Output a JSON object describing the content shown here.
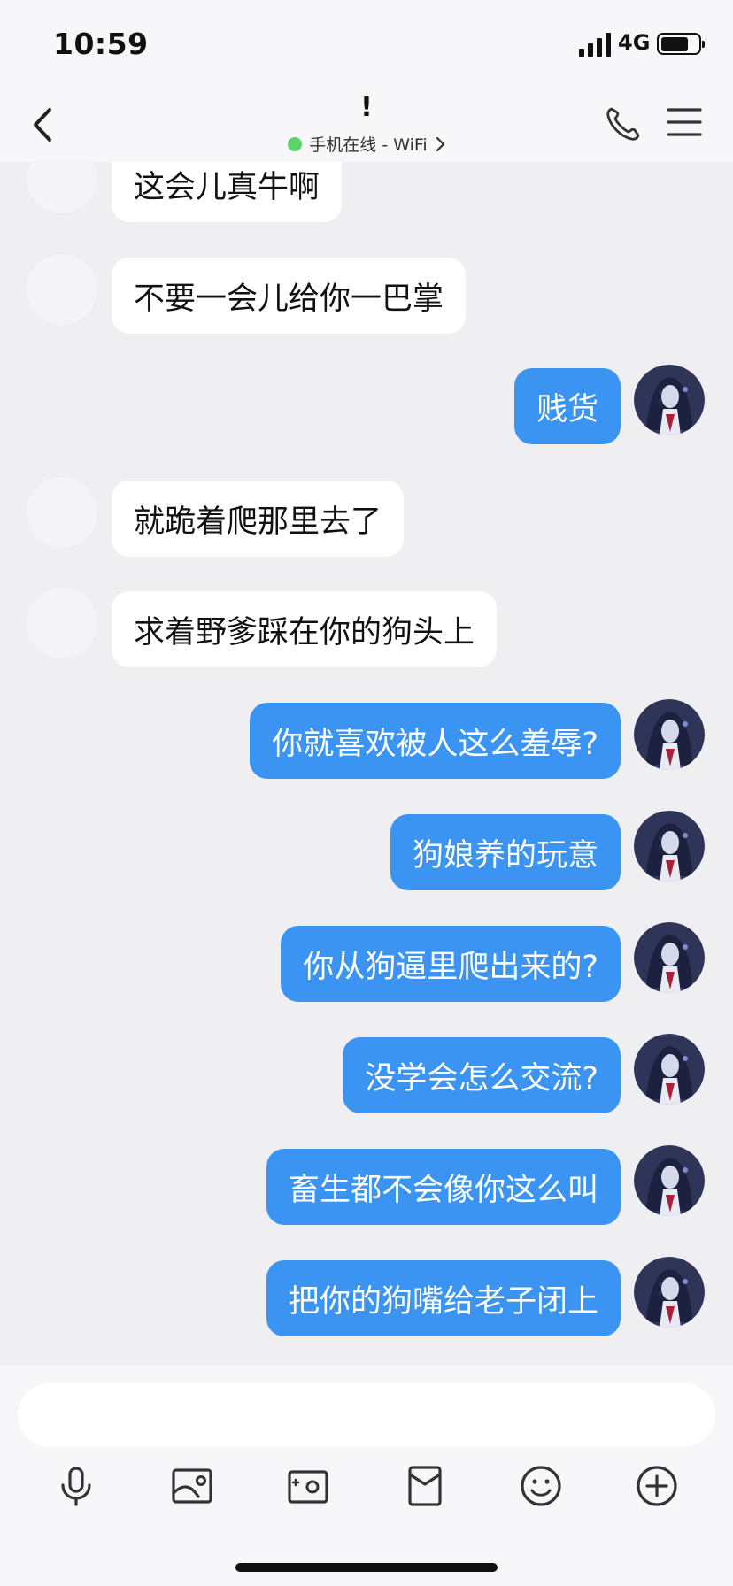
{
  "status_bar": {
    "time": "10:59",
    "network": "4G"
  },
  "header": {
    "title": "!",
    "presence_text": "手机在线 - WiFi"
  },
  "messages": [
    {
      "side": "in",
      "text": "这会儿真牛啊"
    },
    {
      "side": "in",
      "text": "不要一会儿给你一巴掌"
    },
    {
      "side": "out",
      "text": "贱货"
    },
    {
      "side": "in",
      "text": "就跪着爬那里去了"
    },
    {
      "side": "in",
      "text": "求着野爹踩在你的狗头上"
    },
    {
      "side": "out",
      "text": "你就喜欢被人这么羞辱?"
    },
    {
      "side": "out",
      "text": "狗娘养的玩意"
    },
    {
      "side": "out",
      "text": "你从狗逼里爬出来的?"
    },
    {
      "side": "out",
      "text": "没学会怎么交流?"
    },
    {
      "side": "out",
      "text": "畜生都不会像你这么叫"
    },
    {
      "side": "out",
      "text": "把你的狗嘴给老子闭上"
    }
  ],
  "toolbar": [
    "microphone-icon",
    "image-icon",
    "camera-icon",
    "red-packet-icon",
    "emoji-icon",
    "plus-icon"
  ],
  "colors": {
    "outgoing_bubble": "#3b94f1",
    "incoming_bubble": "#ffffff",
    "background": "#efeff1",
    "online": "#5ed36a"
  }
}
